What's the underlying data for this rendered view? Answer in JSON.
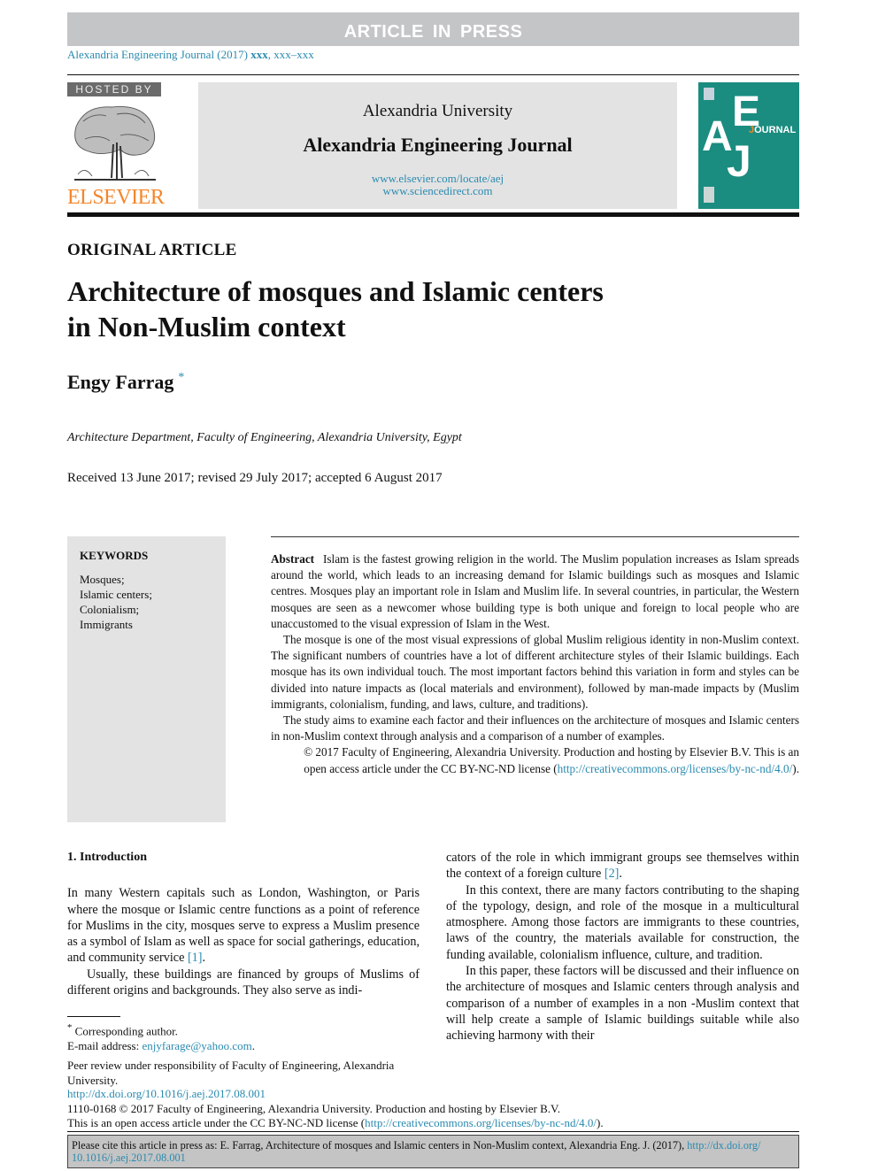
{
  "header": {
    "press_banner": "ARTICLE IN PRESS",
    "journal_line_prefix": "Alexandria Engineering Journal (2017) ",
    "journal_line_vol": "xxx",
    "journal_line_pages": ", xxx–xxx"
  },
  "masthead": {
    "hosted_by": "HOSTED BY",
    "publisher_logo": "ELSEVIER",
    "publisher_logo_color": "#f5852a",
    "university": "Alexandria University",
    "journal_name": "Alexandria Engineering Journal",
    "url_1": "www.elsevier.com/locate/aej",
    "url_2": "www.sciencedirect.com",
    "cover": {
      "letter_a": "A",
      "letter_e": "E",
      "letter_j": "J",
      "word_initial": "J",
      "word_rest": "OURNAL",
      "cover_color": "#1b8c80"
    }
  },
  "article": {
    "type": "ORIGINAL ARTICLE",
    "title_line_1": "Architecture of mosques and Islamic centers",
    "title_line_2": "in Non-Muslim context",
    "author": "Engy Farrag",
    "author_mark": "*",
    "affiliation": "Architecture Department, Faculty of Engineering, Alexandria University, Egypt",
    "dates": "Received 13 June 2017; revised 29 July 2017; accepted 6 August 2017"
  },
  "keywords": {
    "heading": "KEYWORDS",
    "items": [
      "Mosques;",
      "Islamic centers;",
      "Colonialism;",
      "Immigrants"
    ]
  },
  "abstract": {
    "label": "Abstract",
    "p1": "Islam is the fastest growing religion in the world. The Muslim population increases as Islam spreads around the world, which leads to an increasing demand for Islamic buildings such as mosques and Islamic centres. Mosques play an important role in Islam and Muslim life. In several countries, in particular, the Western mosques are seen as a newcomer whose building type is both unique and foreign to local people who are unaccustomed to the visual expression of Islam in the West.",
    "p2": "The mosque is one of the most visual expressions of global Muslim religious identity in non-Muslim context. The significant numbers of countries have a lot of different architecture styles of their Islamic buildings. Each mosque has its own individual touch. The most important factors behind this variation in form and styles can be divided into nature impacts as (local materials and environment), followed by man-made impacts by (Muslim immigrants, colonialism, funding, and laws, culture, and traditions).",
    "p3": "The study aims to examine each factor and their influences on the architecture of mosques and Islamic centers in non-Muslim context through analysis and a comparison of a number of examples.",
    "copyright_1": "© 2017 Faculty of Engineering, Alexandria University. Production and hosting by Elsevier B.V. This is an",
    "copyright_2": "open access article under the CC BY-NC-ND license (",
    "license_url": "http://creativecommons.org/licenses/by-nc-nd/4.0/",
    "copyright_end": ")."
  },
  "body": {
    "section_heading": "1. Introduction",
    "left_p1": "In many Western capitals such as London, Washington, or Paris where the mosque or Islamic centre functions as a point of reference for Muslims in the city, mosques serve to express a Muslim presence as a symbol of Islam as well as space for social gatherings, education, and community service ",
    "left_p1_ref": "[1]",
    "left_p1_end": ".",
    "left_p2": "Usually, these buildings are financed by groups of Muslims of different origins and backgrounds. They also serve as indi-",
    "right_p1": "cators of the role in which immigrant groups see themselves within the context of a foreign culture ",
    "right_p1_ref": "[2]",
    "right_p1_end": ".",
    "right_p2": "In this context, there are many factors contributing to the shaping of the typology, design, and role of the mosque in a multicultural atmosphere. Among those factors are immigrants to these countries, laws of the country, the materials available for construction, the funding available, colonialism influence, culture, and tradition.",
    "right_p3": "In this paper, these factors will be discussed and their influence on the architecture of mosques and Islamic centers through analysis and comparison of a number of examples in a non -Muslim context that will help create a sample of Islamic buildings suitable while also achieving harmony with their"
  },
  "footnotes": {
    "corresponding_mark": "*",
    "corresponding": "Corresponding author.",
    "email_label": "E-mail address: ",
    "email": "enjyfarage@yahoo.com",
    "email_end": ".",
    "peer_review": "Peer review under responsibility of Faculty of Engineering, Alexandria University.",
    "doi_url": "http://dx.doi.org/10.1016/j.aej.2017.08.001",
    "issn_line": "1110-0168 © 2017 Faculty of Engineering, Alexandria University. Production and hosting by Elsevier B.V.",
    "license_line_prefix": "This is an open access article under the CC BY-NC-ND license (",
    "license_url": "http://creativecommons.org/licenses/by-nc-nd/4.0/",
    "license_line_end": ")."
  },
  "citation_box": {
    "text": "Please cite this article in press as: E. Farrag, Architecture of mosques and Islamic centers in Non-Muslim context,  Alexandria Eng. J. (2017), ",
    "doi_url_part_1": "http://dx.doi.org/",
    "doi_url_part_2": "10.1016/j.aej.2017.08.001"
  }
}
